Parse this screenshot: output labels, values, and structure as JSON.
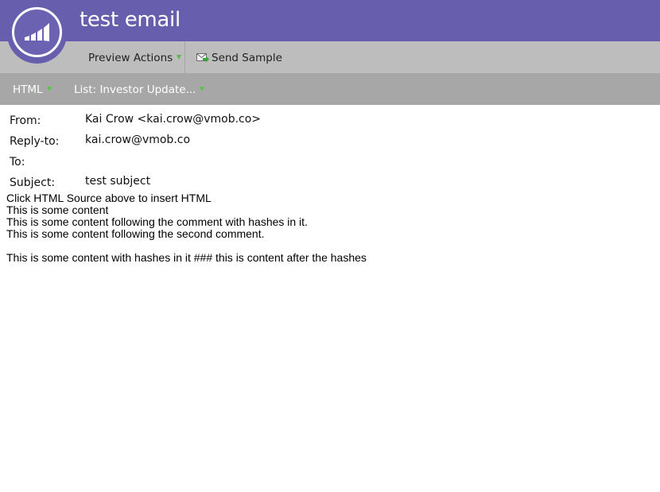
{
  "header": {
    "title": "test email",
    "logo_icon": "marketo-bars-icon",
    "bg_color": "#675ead"
  },
  "toolbar": {
    "preview_actions_label": "Preview Actions",
    "send_sample_label": "Send Sample"
  },
  "subtoolbar": {
    "format_label": "HTML",
    "list_label": "List: Investor Update..."
  },
  "email": {
    "from_label": "From:",
    "from_value": "Kai Crow <kai.crow@vmob.co>",
    "reply_to_label": "Reply-to:",
    "reply_to_value": "kai.crow@vmob.co",
    "to_label": "To:",
    "to_value": "",
    "subject_label": "Subject:",
    "subject_value": "test subject"
  },
  "body": {
    "lines": [
      "Click HTML Source above to insert HTML",
      "This is some content",
      "This is some content following the comment with hashes in it.",
      "This is some content following the second comment.",
      "This is some content with hashes in it ### this is content after the hashes"
    ]
  }
}
